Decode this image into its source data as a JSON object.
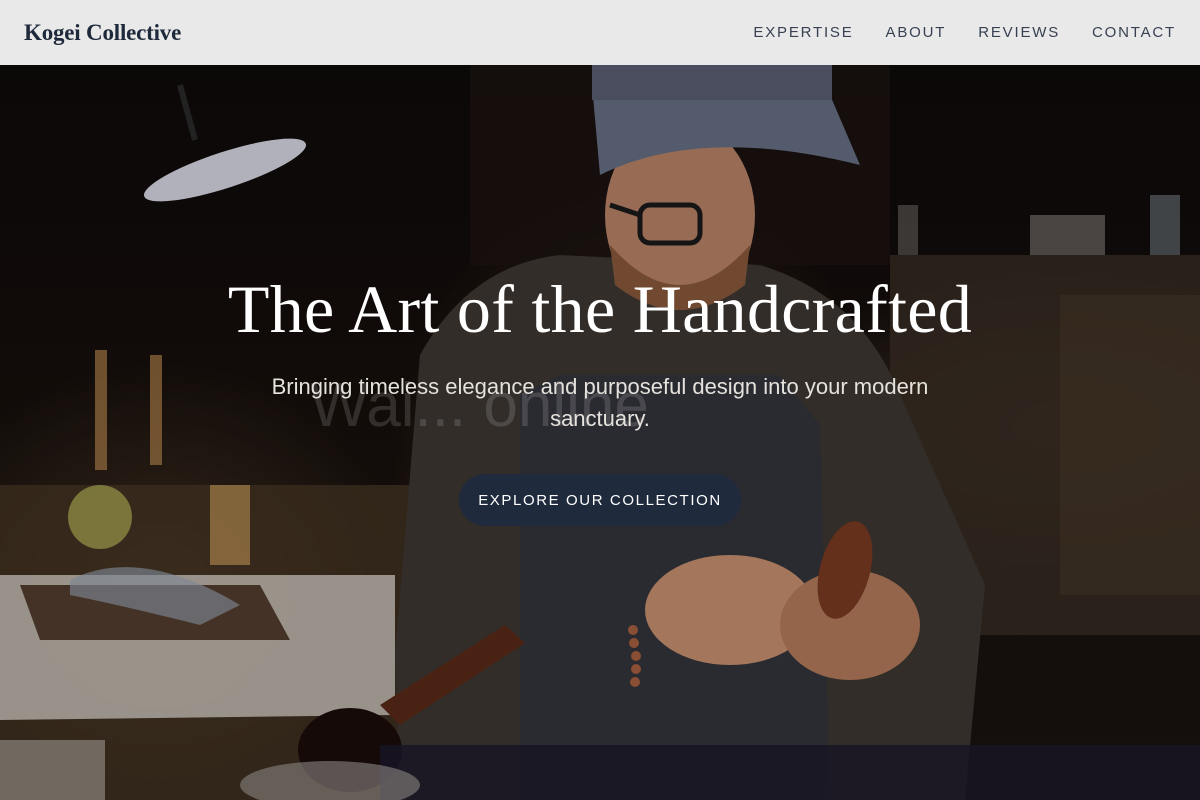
{
  "header": {
    "brand": "Kogei Collective",
    "nav": [
      {
        "label": "EXPERTISE"
      },
      {
        "label": "ABOUT"
      },
      {
        "label": "REVIEWS"
      },
      {
        "label": "CONTACT"
      }
    ]
  },
  "hero": {
    "title": "The Art of the Handcrafted",
    "subtitle": "Bringing timeless elegance and purposeful design into your modern sanctuary.",
    "cta_label": "EXPLORE OUR COLLECTION",
    "watermark": "Wai... online"
  },
  "colors": {
    "header_bg": "#e9e9e9",
    "brand_text": "#1e293b",
    "cta_bg": "#1f2a3d",
    "hero_title": "#ffffff"
  }
}
